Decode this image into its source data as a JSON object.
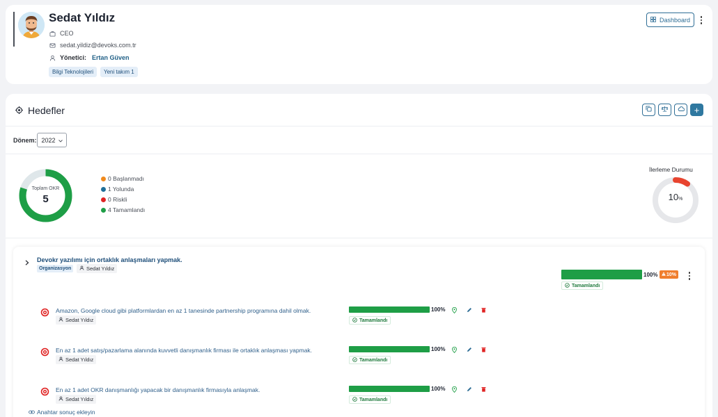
{
  "profile": {
    "name": "Sedat Yıldız",
    "role": "CEO",
    "email": "sedat.yildiz@devoks.com.tr",
    "manager_label": "Yönetici:",
    "manager_name": "Ertan Güven",
    "tags": [
      "Bilgi Teknolojileri",
      "Yeni takım 1"
    ],
    "dashboard_label": "Dashboard"
  },
  "goals": {
    "title": "Hedefler",
    "period_label": "Dönem:",
    "period_value": "2022",
    "add_label": "+"
  },
  "summary": {
    "total_label": "Toplam OKR",
    "total_value": "5",
    "completed_fraction": 0.8,
    "legend": [
      {
        "text": "0 Başlanmadı",
        "color": "#f08a1c"
      },
      {
        "text": "1 Yolunda",
        "color": "#1f6f99"
      },
      {
        "text": "0 Riskli",
        "color": "#e02424"
      },
      {
        "text": "4 Tamamlandı",
        "color": "#1e9e46"
      }
    ],
    "progress_title": "İlerleme Durumu",
    "progress_value": "10",
    "progress_unit": "%",
    "progress_fraction": 0.1
  },
  "objective": {
    "title": "Devokr yazılımı için ortaklık anlaşmaları yapmak.",
    "org_badge": "Organizasyon",
    "owner": "Sedat Yıldız",
    "progress": 1.0,
    "progress_text": "100%",
    "risk_text": "10%",
    "status": "Tamamlandı"
  },
  "key_results": [
    {
      "title": "Amazon, Google cloud gibi platformlardan en az 1 tanesinde partnership programına dahil olmak.",
      "owner": "Sedat Yıldız",
      "progress": 1.0,
      "progress_text": "100%",
      "status": "Tamamlandı"
    },
    {
      "title": "En az 1 adet satış/pazarlama alanında kuvvetli danışmanlık firması ile ortaklık anlaşması yapmak.",
      "owner": "Sedat Yıldız",
      "progress": 1.0,
      "progress_text": "100%",
      "status": "Tamamlandı"
    },
    {
      "title": "En az 1 adet OKR danışmanlığı yapacak bir danışmanlık firmasıyla anlaşmak.",
      "owner": "Sedat Yıldız",
      "progress": 1.0,
      "progress_text": "100%",
      "status": "Tamamlandı"
    }
  ],
  "add_key_result_label": "Anahtar sonuç ekleyin",
  "colors": {
    "accent": "#2f78a0",
    "success": "#1e9e46",
    "danger": "#e02424",
    "warning": "#f07e2d",
    "gauge_red": "#e8442f"
  },
  "icons": [
    "briefcase-icon",
    "mail-icon",
    "user-icon",
    "grid-icon",
    "target-icon",
    "copy-icon",
    "scale-icon",
    "cloud-icon",
    "chevron-right-icon",
    "alert-icon",
    "check-circle-icon",
    "location-icon",
    "edit-icon",
    "trash-icon",
    "link-icon"
  ]
}
